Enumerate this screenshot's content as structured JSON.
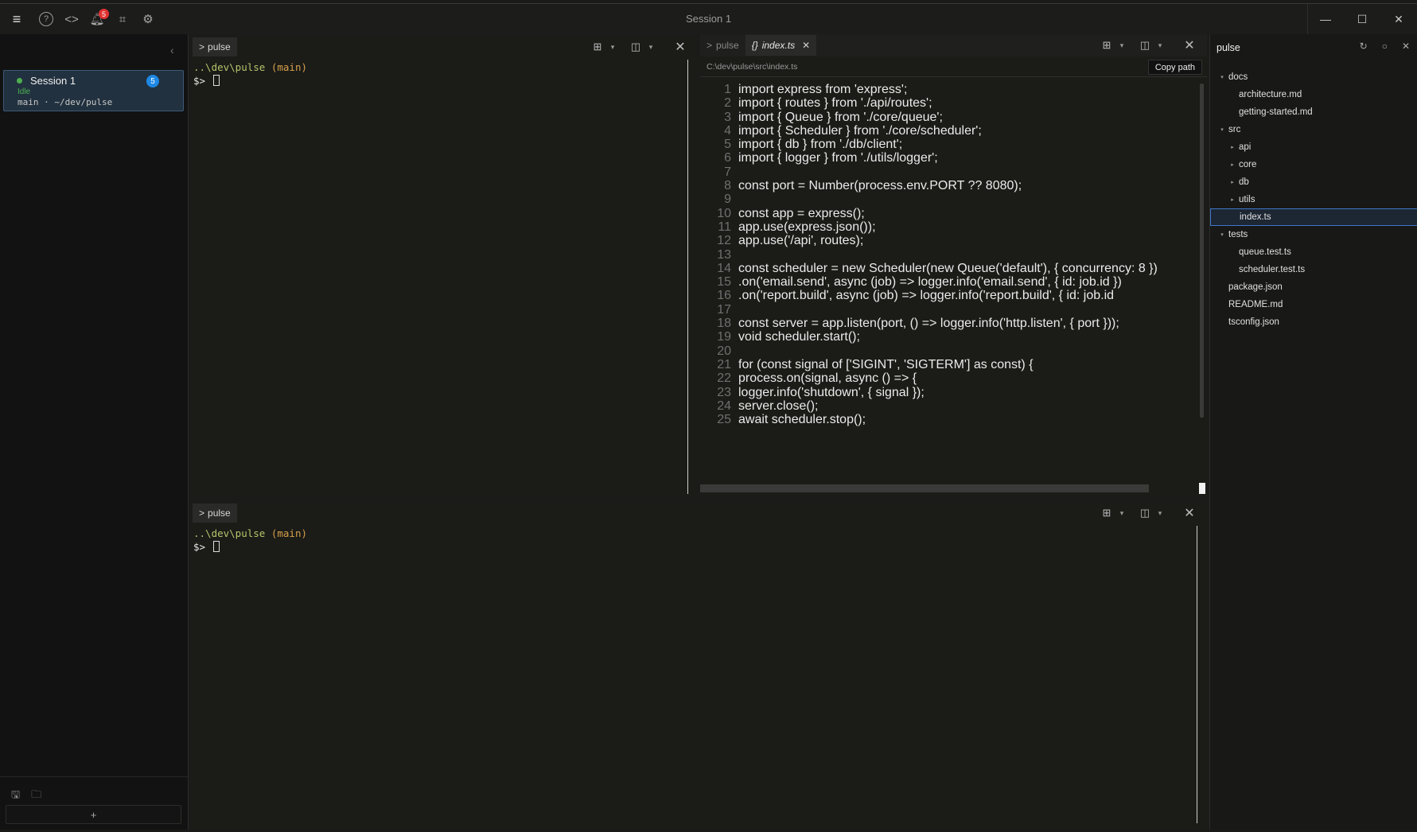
{
  "window": {
    "title": "Session 1",
    "notification_count": "5"
  },
  "sidebar": {
    "session": {
      "name": "Session 1",
      "badge": "5",
      "status": "Idle",
      "branch_path": "main · ~/dev/pulse"
    },
    "new_session_label": "+"
  },
  "terminal_top": {
    "tab_label": "pulse",
    "path": "..\\dev\\pulse",
    "branch": "(main)",
    "prompt": "$>"
  },
  "terminal_bottom": {
    "tab_label": "pulse",
    "path": "..\\dev\\pulse",
    "branch": "(main)",
    "prompt": "$>"
  },
  "editor": {
    "tabs": [
      {
        "label": "pulse"
      },
      {
        "label": "index.ts"
      }
    ],
    "file_path": "C:\\dev\\pulse\\src\\index.ts",
    "copy_path_label": "Copy path",
    "lines": [
      {
        "n": "1",
        "text": "import express from 'express';"
      },
      {
        "n": "2",
        "text": "import { routes } from './api/routes';"
      },
      {
        "n": "3",
        "text": "import { Queue } from './core/queue';"
      },
      {
        "n": "4",
        "text": "import { Scheduler } from './core/scheduler';"
      },
      {
        "n": "5",
        "text": "import { db } from './db/client';"
      },
      {
        "n": "6",
        "text": "import { logger } from './utils/logger';"
      },
      {
        "n": "7",
        "text": ""
      },
      {
        "n": "8",
        "text": "const port = Number(process.env.PORT ?? 8080);"
      },
      {
        "n": "9",
        "text": ""
      },
      {
        "n": "10",
        "text": "const app = express();"
      },
      {
        "n": "11",
        "text": "app.use(express.json());"
      },
      {
        "n": "12",
        "text": "app.use('/api', routes);"
      },
      {
        "n": "13",
        "text": ""
      },
      {
        "n": "14",
        "text": "const scheduler = new Scheduler(new Queue('default'), { concurrency: 8 })"
      },
      {
        "n": "15",
        "text": "  .on('email.send', async (job) => logger.info('email.send', { id: job.id })"
      },
      {
        "n": "16",
        "text": "  .on('report.build', async (job) => logger.info('report.build', { id: job.id"
      },
      {
        "n": "17",
        "text": ""
      },
      {
        "n": "18",
        "text": "const server = app.listen(port, () => logger.info('http.listen', { port }));"
      },
      {
        "n": "19",
        "text": "void scheduler.start();"
      },
      {
        "n": "20",
        "text": ""
      },
      {
        "n": "21",
        "text": "for (const signal of ['SIGINT', 'SIGTERM'] as const) {"
      },
      {
        "n": "22",
        "text": "  process.on(signal, async () => {"
      },
      {
        "n": "23",
        "text": "    logger.info('shutdown', { signal });"
      },
      {
        "n": "24",
        "text": "    server.close();"
      },
      {
        "n": "25",
        "text": "    await scheduler.stop();"
      }
    ]
  },
  "explorer": {
    "title": "pulse",
    "items": [
      {
        "label": "docs",
        "depth": 0,
        "type": "folder",
        "open": true
      },
      {
        "label": "architecture.md",
        "depth": 1,
        "type": "file"
      },
      {
        "label": "getting-started.md",
        "depth": 1,
        "type": "file"
      },
      {
        "label": "src",
        "depth": 0,
        "type": "folder",
        "open": true
      },
      {
        "label": "api",
        "depth": 1,
        "type": "folder",
        "open": false
      },
      {
        "label": "core",
        "depth": 1,
        "type": "folder",
        "open": false
      },
      {
        "label": "db",
        "depth": 1,
        "type": "folder",
        "open": false
      },
      {
        "label": "utils",
        "depth": 1,
        "type": "folder",
        "open": false
      },
      {
        "label": "index.ts",
        "depth": 1,
        "type": "file",
        "selected": true
      },
      {
        "label": "tests",
        "depth": 0,
        "type": "folder",
        "open": true
      },
      {
        "label": "queue.test.ts",
        "depth": 1,
        "type": "file"
      },
      {
        "label": "scheduler.test.ts",
        "depth": 1,
        "type": "file"
      },
      {
        "label": "package.json",
        "depth": 0,
        "type": "file"
      },
      {
        "label": "README.md",
        "depth": 0,
        "type": "file"
      },
      {
        "label": "tsconfig.json",
        "depth": 0,
        "type": "file"
      }
    ]
  }
}
